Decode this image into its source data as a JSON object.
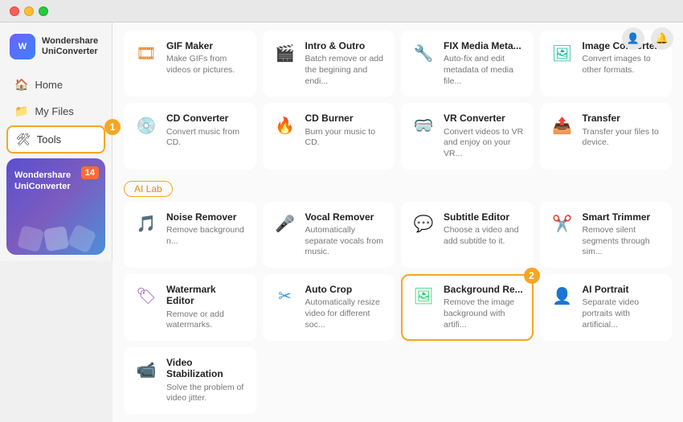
{
  "titleBar": {
    "buttons": [
      "close",
      "minimize",
      "maximize"
    ]
  },
  "sidebar": {
    "logo": {
      "text1": "Wondershare",
      "text2": "UniConverter"
    },
    "navItems": [
      {
        "id": "home",
        "label": "Home",
        "icon": "🏠",
        "active": false
      },
      {
        "id": "myfiles",
        "label": "My Files",
        "icon": "📁",
        "active": false
      },
      {
        "id": "tools",
        "label": "Tools",
        "icon": "🛠",
        "active": true
      }
    ],
    "promo": {
      "title1": "Wondershare",
      "title2": "UniConverter",
      "badge": "14",
      "badge_label": "14"
    }
  },
  "header": {
    "icons": [
      "👤",
      "🔔"
    ]
  },
  "sections": {
    "top": {
      "tools": [
        {
          "id": "gif-maker",
          "name": "GIF Maker",
          "desc": "Make GIFs from videos or pictures.",
          "icon": "🎞",
          "iconColor": "#e67e22"
        },
        {
          "id": "intro-outro",
          "name": "Intro & Outro",
          "desc": "Batch remove or add the begining and endi...",
          "icon": "🎬",
          "iconColor": "#3498db"
        },
        {
          "id": "fix-media",
          "name": "FIX Media Meta...",
          "desc": "Auto-fix and edit metadata of media file...",
          "icon": "🔧",
          "iconColor": "#9b59b6"
        },
        {
          "id": "image-converter",
          "name": "Image Converter",
          "desc": "Convert images to other formats.",
          "icon": "🖼",
          "iconColor": "#1abc9c"
        },
        {
          "id": "cd-converter",
          "name": "CD Converter",
          "desc": "Convert music from CD.",
          "icon": "💿",
          "iconColor": "#e74c3c"
        },
        {
          "id": "cd-burner",
          "name": "CD Burner",
          "desc": "Burn your music to CD.",
          "icon": "🔥",
          "iconColor": "#f39c12"
        },
        {
          "id": "vr-converter",
          "name": "VR Converter",
          "desc": "Convert videos to VR and enjoy on your VR...",
          "icon": "🥽",
          "iconColor": "#2ecc71"
        },
        {
          "id": "transfer",
          "name": "Transfer",
          "desc": "Transfer your files to device.",
          "icon": "📤",
          "iconColor": "#3498db"
        }
      ]
    },
    "aiLab": {
      "label": "AI Lab",
      "tools": [
        {
          "id": "noise-remover",
          "name": "Noise Remover",
          "desc": "Remove background n...",
          "icon": "🎵",
          "iconColor": "#7f8c8d"
        },
        {
          "id": "vocal-remover",
          "name": "Vocal Remover",
          "desc": "Automatically separate vocals from music.",
          "icon": "🎤",
          "iconColor": "#e74c3c"
        },
        {
          "id": "subtitle-editor",
          "name": "Subtitle Editor",
          "desc": "Choose a video and add subtitle to it.",
          "icon": "💬",
          "iconColor": "#3498db"
        },
        {
          "id": "smart-trimmer",
          "name": "Smart Trimmer",
          "desc": "Remove silent segments through sim...",
          "icon": "✂️",
          "iconColor": "#f39c12"
        },
        {
          "id": "watermark-editor",
          "name": "Watermark Editor",
          "desc": "Remove or add watermarks.",
          "icon": "🏷",
          "iconColor": "#9b59b6",
          "highlighted": false
        },
        {
          "id": "auto-crop",
          "name": "Auto Crop",
          "desc": "Automatically resize video for different soc...",
          "icon": "✂",
          "iconColor": "#3498db"
        },
        {
          "id": "background-remove",
          "name": "Background Re...",
          "desc": "Remove the image background with artifi...",
          "icon": "🖼",
          "iconColor": "#2ecc71",
          "highlighted": true
        },
        {
          "id": "ai-portrait",
          "name": "AI Portrait",
          "desc": "Separate video portraits with artificial...",
          "icon": "👤",
          "iconColor": "#e74c3c"
        },
        {
          "id": "video-stabilization",
          "name": "Video Stabilization",
          "desc": "Solve the problem of video jitter.",
          "icon": "📹",
          "iconColor": "#f39c12"
        }
      ]
    }
  },
  "steps": {
    "step1": "1",
    "step2": "2"
  }
}
